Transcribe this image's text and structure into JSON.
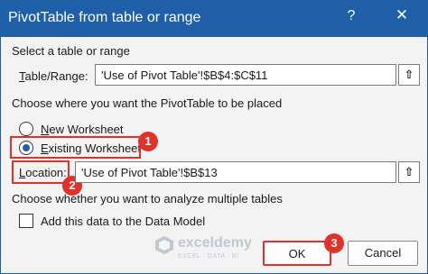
{
  "window": {
    "title": "PivotTable from table or range",
    "help_glyph": "?",
    "close_glyph": "✕"
  },
  "select_section": {
    "heading": "Select a table or range",
    "table_range_label_prefix": "",
    "table_range_label_u": "T",
    "table_range_label_rest": "able/Range:",
    "table_range_value": "'Use of Pivot Table'!$B$4:$C$11",
    "collapse_glyph": "⇧"
  },
  "placement_section": {
    "heading": "Choose where you want the PivotTable to be placed",
    "new_ws_u": "N",
    "new_ws_rest": "ew Worksheet",
    "new_ws_checked": false,
    "existing_ws_u": "E",
    "existing_ws_rest": "xisting Worksheet",
    "existing_ws_checked": true,
    "location_u": "L",
    "location_rest": "ocation:",
    "location_value": "'Use of Pivot Table'!$B$13",
    "collapse_glyph": "⇧"
  },
  "multiple_section": {
    "heading": "Choose whether you want to analyze multiple tables",
    "data_model_label": "Add this data to the Data Model",
    "data_model_checked": false
  },
  "buttons": {
    "ok": "OK",
    "cancel": "Cancel"
  },
  "annotations": {
    "step1": "1",
    "step2": "2",
    "step3": "3",
    "color": "#e0312a"
  },
  "watermark": {
    "name": "exceldemy",
    "tagline": "EXCEL · DATA · BI"
  },
  "colors": {
    "title_bar": "#1f5fa8",
    "dialog_bg": "#f3f3f3"
  }
}
